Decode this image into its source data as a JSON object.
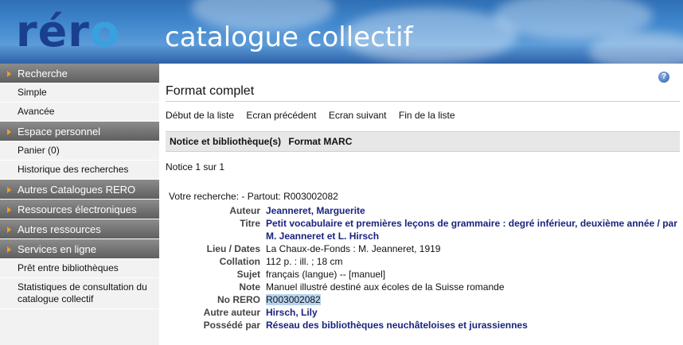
{
  "banner": {
    "logo_part1": "rér",
    "logo_part2": "o",
    "title": "catalogue collectif"
  },
  "sidebar": {
    "sections": [
      {
        "header": "Recherche",
        "items": [
          "Simple",
          "Avancée"
        ]
      },
      {
        "header": "Espace personnel",
        "items": [
          "Panier (0)",
          "Historique des recherches"
        ]
      },
      {
        "header": "Autres Catalogues RERO",
        "items": []
      },
      {
        "header": "Ressources électroniques",
        "items": []
      },
      {
        "header": "Autres ressources",
        "items": []
      },
      {
        "header": "Services en ligne",
        "items": [
          "Prêt entre bibliothèques",
          "Statistiques de consultation du catalogue collectif"
        ]
      }
    ]
  },
  "help_icon": "?",
  "main": {
    "title": "Format complet",
    "nav": [
      "Début de la liste",
      "Ecran précédent",
      "Ecran suivant",
      "Fin de la liste"
    ],
    "tabs": [
      "Notice et bibliothèque(s)",
      "Format MARC"
    ],
    "notice_count": "Notice 1 sur 1",
    "search_line": "Votre recherche: - Partout: R003002082"
  },
  "record": [
    {
      "label": "Auteur",
      "value": "Jeanneret, Marguerite",
      "link": true
    },
    {
      "label": "Titre",
      "value": "Petit vocabulaire et premières leçons de grammaire : degré inférieur, deuxième année / par M. Jeanneret et L. Hirsch",
      "link": true
    },
    {
      "label": "Lieu / Dates",
      "value": "La Chaux-de-Fonds : M. Jeanneret, 1919",
      "link": false
    },
    {
      "label": "Collation",
      "value": "112 p. : ill. ; 18 cm",
      "link": false
    },
    {
      "label": "Sujet",
      "value": "français (langue) -- [manuel]",
      "link": false
    },
    {
      "label": "Note",
      "value": "Manuel illustré destiné aux écoles de la Suisse romande",
      "link": false
    },
    {
      "label": "No RERO",
      "value": "R003002082",
      "link": false,
      "highlight": true
    },
    {
      "label": "Autre auteur",
      "value": "Hirsch, Lily",
      "link": true
    },
    {
      "label": "Possédé par",
      "value": "Réseau des bibliothèques neuchâteloises et jurassiennes",
      "link": true
    }
  ]
}
